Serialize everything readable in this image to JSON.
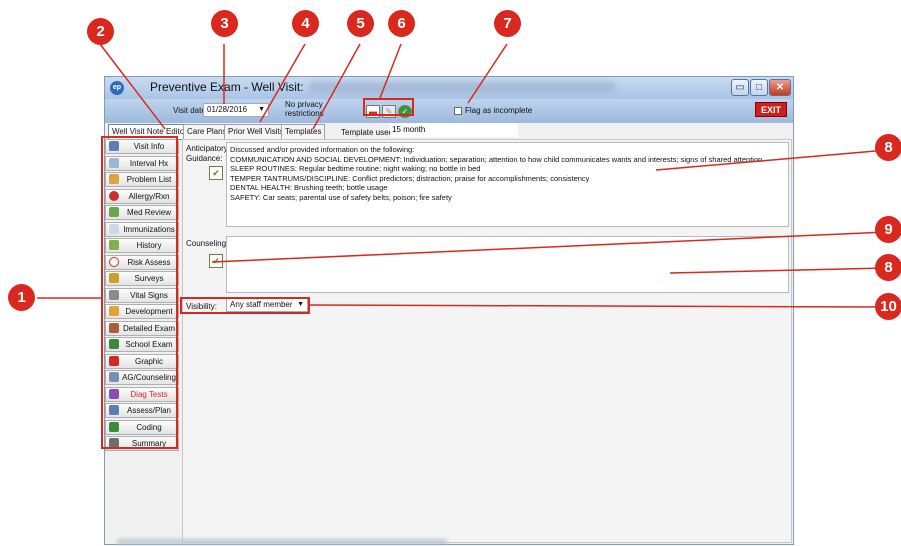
{
  "window": {
    "title": "Preventive Exam - Well Visit:",
    "icon": "app-logo-icon",
    "exit_label": "EXIT",
    "minimize_label": "▭",
    "maximize_label": "□",
    "close_label": "✕"
  },
  "header": {
    "visit_date_label": "Visit date:",
    "visit_date_value": "01/28/2016",
    "privacy_text": "No privacy restrictions",
    "flag_label": "Flag as incomplete"
  },
  "tabs": [
    {
      "label": "Well Visit Note Editor"
    },
    {
      "label": "Care Plans"
    },
    {
      "label": "Prior Well Visits"
    },
    {
      "label": "Templates"
    }
  ],
  "template_used_label": "Template used:",
  "template_used_value": "15 month",
  "sidebar": {
    "items": [
      {
        "label": "Visit Info",
        "color": "#5b7fb5"
      },
      {
        "label": "Interval Hx",
        "color": "#9bb7d8"
      },
      {
        "label": "Problem List",
        "color": "#d9a441"
      },
      {
        "label": "Allergy/Rxn",
        "color": "#c9302c"
      },
      {
        "label": "Med Review",
        "color": "#6aa84f"
      },
      {
        "label": "Immunizations",
        "color": "#cfd8e6"
      },
      {
        "label": "History",
        "color": "#7fb24a"
      },
      {
        "label": "Risk Assess",
        "color": "#d9281e"
      },
      {
        "label": "Surveys",
        "color": "#c9a227"
      },
      {
        "label": "Vital Signs",
        "color": "#8a8a8a"
      },
      {
        "label": "Development",
        "color": "#e0a23a"
      },
      {
        "label": "Detailed Exam",
        "color": "#b05a3a"
      },
      {
        "label": "School Exam",
        "color": "#3b8a3b"
      },
      {
        "label": "Graphic",
        "color": "#d9281e"
      },
      {
        "label": "AG/Counseling",
        "color": "#7a8fb3"
      },
      {
        "label": "Diag Tests",
        "color": "#8a4fb5"
      },
      {
        "label": "Assess/Plan",
        "color": "#5b7fb5"
      },
      {
        "label": "Coding",
        "color": "#3b8a3b"
      },
      {
        "label": "Summary",
        "color": "#6f6f6f"
      }
    ]
  },
  "anticipatory": {
    "label_line1": "Anticipatory",
    "label_line2": "Guidance:",
    "lines": [
      "Discussed and/or provided information on the following:",
      "COMMUNICATION AND SOCIAL DEVELOPMENT: Individuation; separation; attention to how child communicates wants and interests; signs of shared attention",
      "SLEEP ROUTINES: Regular bedtime routine; night waking; no bottle in bed",
      "TEMPER TANTRUMS/DISCIPLINE: Conflict predictors; distraction; praise for accomplishments; consistency",
      "DENTAL HEALTH: Brushing teeth; bottle usage",
      "SAFETY: Car seats; parental use of safety belts; poison; fire safety"
    ]
  },
  "counseling": {
    "label": "Counseling:"
  },
  "visibility": {
    "label": "Visibility:",
    "value": "Any staff member"
  },
  "callouts": [
    "1",
    "2",
    "3",
    "4",
    "5",
    "6",
    "7",
    "8",
    "9",
    "8",
    "10"
  ],
  "colors": {
    "callout": "#d9281e",
    "diag_tests_text": "#d9281e"
  }
}
